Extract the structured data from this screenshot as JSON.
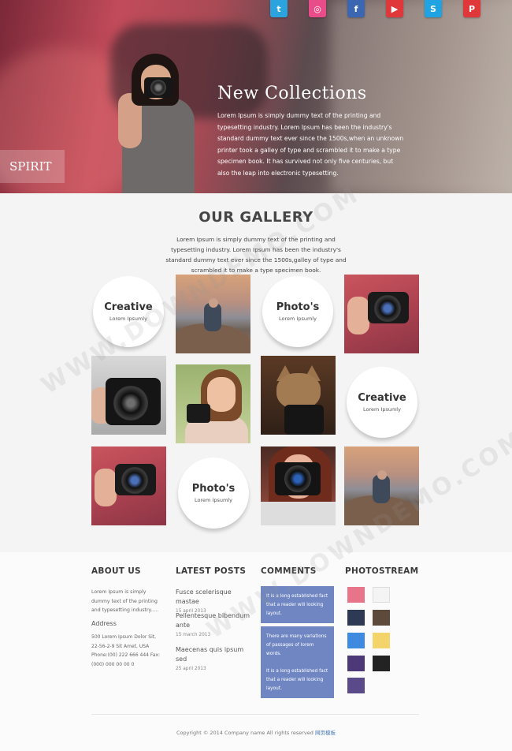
{
  "hero": {
    "title": "New Collections",
    "text": "Lorem Ipsum is simply dummy text of the printing and typesetting industry. Lorem Ipsum has been the industry's standard dummy text ever since the 1500s,when an unknown printer took a galley of type and scrambled it to make a type specimen book. It has survived not only five centuries, but also the leap into electronic typesetting.",
    "brand": "SPIRIT"
  },
  "social": [
    {
      "name": "twitter",
      "glyph": "t",
      "color": "#2aa3df"
    },
    {
      "name": "dribbble",
      "glyph": "◎",
      "color": "#e84d8a"
    },
    {
      "name": "facebook",
      "glyph": "f",
      "color": "#3b66b2"
    },
    {
      "name": "youtube",
      "glyph": "▶",
      "color": "#e0383a"
    },
    {
      "name": "skype",
      "glyph": "S",
      "color": "#1fa3e2"
    },
    {
      "name": "pinterest",
      "glyph": "P",
      "color": "#e0383a"
    }
  ],
  "gallery": {
    "title": "OUR GALLERY",
    "desc": "Lorem Ipsum is simply dummy text of the printing and typesetting industry. Lorem Ipsum has been the industry's standard dummy text ever since the 1500s,galley of type and scrambled it to make a type specimen book.",
    "circles": [
      {
        "title": "Creative",
        "sub": "Lorem Ipsumly"
      },
      {
        "title": "Photo's",
        "sub": "Lorem Ipsumly"
      },
      {
        "title": "Creative",
        "sub": "Lorem Ipsumly"
      },
      {
        "title": "Photo's",
        "sub": "Lorem Ipsumly"
      }
    ]
  },
  "footer": {
    "about": {
      "heading": "ABOUT US",
      "text": "Lorem Ipsum is simply dummy text of the printing and typesetting industry.....",
      "address_heading": "Address",
      "address": "500 Lorem Ipsum Dolor Sit, 22-56-2-9 Sit Amet, USA Phone:(00) 222 666 444 Fax: (000) 000 00 00 0"
    },
    "posts": {
      "heading": "LATEST POSTS",
      "items": [
        {
          "title": "Fusce scelerisque mastae",
          "date": "15 april 2013"
        },
        {
          "title": "Pellentesque bibendum ante",
          "date": "15 march 2013"
        },
        {
          "title": "Maecenas quis ipsum sed",
          "date": "25 april 2013"
        }
      ]
    },
    "comments": {
      "heading": "COMMENTS",
      "items": [
        "It is a long established fact that a reader will looking layout.",
        "There are many variations of passages of lorem words.",
        "It is a long established fact that a reader will looking layout."
      ]
    },
    "photostream": {
      "heading": "PHOTOSTREAM",
      "thumbs": [
        {
          "icon": "heart-thumb",
          "color": "#e8748a"
        },
        {
          "icon": "logo-thumb",
          "color": "#f4f4f4"
        },
        {
          "icon": "dark-thumb",
          "color": "#2e3a54"
        },
        {
          "icon": "mosaic-thumb",
          "color": "#5d4a3a"
        },
        {
          "icon": "blue-thumb",
          "color": "#3d8ae0"
        },
        {
          "icon": "yellow-thumb",
          "color": "#f3d46a"
        },
        {
          "icon": "purple-thumb",
          "color": "#4d3878"
        },
        {
          "icon": "cat-thumb",
          "color": "#232323"
        },
        {
          "icon": "pixel-thumb",
          "color": "#5a4a8a"
        }
      ]
    },
    "copyright": "Copyright © 2014 Company name All rights reserved",
    "copyright_link": "网页模板"
  },
  "watermark": "WWW.DOWNDEMO.COM"
}
